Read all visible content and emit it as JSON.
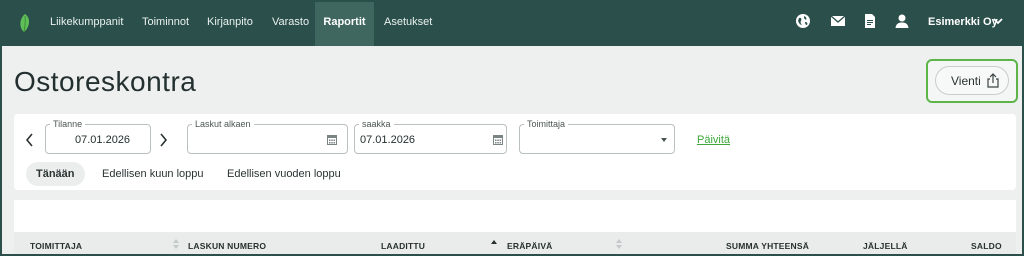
{
  "nav": {
    "items": [
      {
        "label": "Liikekumppanit",
        "active": false
      },
      {
        "label": "Toiminnot",
        "active": false
      },
      {
        "label": "Kirjanpito",
        "active": false
      },
      {
        "label": "Varasto",
        "active": false
      },
      {
        "label": "Raportit",
        "active": true
      },
      {
        "label": "Asetukset",
        "active": false
      }
    ],
    "icons": [
      "globe-icon",
      "mail-icon",
      "document-icon",
      "user-icon"
    ],
    "company": "Esimerkki Oy"
  },
  "page": {
    "title": "Ostoreskontra",
    "export_label": "Vienti"
  },
  "filters": {
    "tilanne": {
      "label": "Tilanne",
      "value": "07.01.2026"
    },
    "laskut_alkaen": {
      "label": "Laskut alkaen",
      "value": ""
    },
    "saakka": {
      "label": "saakka",
      "value": "07.01.2026"
    },
    "toimittaja": {
      "label": "Toimittaja",
      "value": ""
    },
    "refresh_label": "Päivitä"
  },
  "tabs": [
    {
      "label": "Tänään",
      "active": true
    },
    {
      "label": "Edellisen kuun loppu",
      "active": false
    },
    {
      "label": "Edellisen vuoden loppu",
      "active": false
    }
  ],
  "table": {
    "columns": [
      "TOIMITTAJA",
      "LASKUN NUMERO",
      "LAADITTU",
      "ERÄPÄIVÄ",
      "SUMMA YHTEENSÄ",
      "JÄLJELLÄ",
      "SALDO"
    ]
  },
  "colors": {
    "header_bg": "#2b4f4b",
    "active_nav_bg": "#40675f",
    "accent_green": "#3ea83a",
    "highlight_border": "#5db54a"
  }
}
